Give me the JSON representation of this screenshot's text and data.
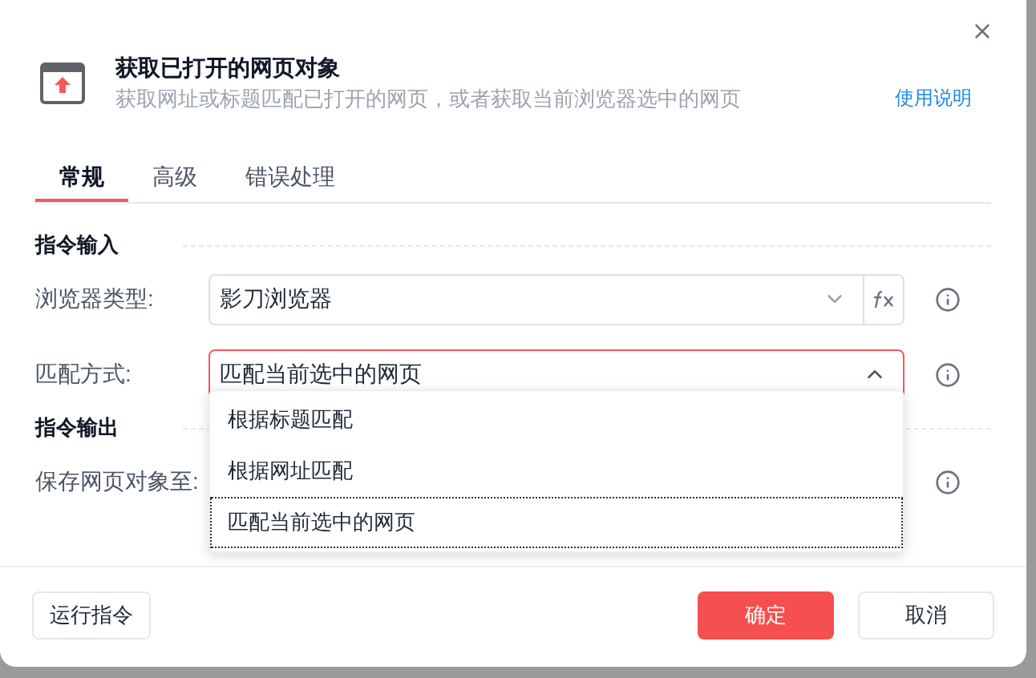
{
  "dialog": {
    "title": "获取已打开的网页对象",
    "subtitle": "获取网址或标题匹配已打开的网页，或者获取当前浏览器选中的网页",
    "help_link": "使用说明"
  },
  "tabs": [
    {
      "label": "常规",
      "selected": true
    },
    {
      "label": "高级",
      "selected": false
    },
    {
      "label": "错误处理",
      "selected": false
    }
  ],
  "sections": [
    {
      "title": "指令输入",
      "rows": [
        {
          "label": "浏览器类型:",
          "kind": "select",
          "value": "影刀浏览器",
          "open": false,
          "fx": true
        },
        {
          "label": "匹配方式:",
          "kind": "select",
          "value": "匹配当前选中的网页",
          "open": true,
          "fx": false
        }
      ]
    },
    {
      "title": "指令输出",
      "rows": [
        {
          "label": "保存网页对象至:",
          "kind": "hidden"
        }
      ]
    }
  ],
  "dropdown_options": [
    {
      "label": "根据标题匹配",
      "selected": false
    },
    {
      "label": "根据网址匹配",
      "selected": false
    },
    {
      "label": "匹配当前选中的网页",
      "selected": true
    }
  ],
  "footer": {
    "run_button": "运行指令",
    "ok_button": "确定",
    "cancel_button": "取消"
  }
}
